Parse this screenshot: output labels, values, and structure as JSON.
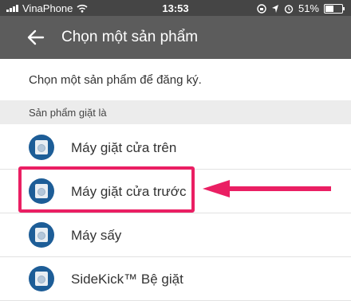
{
  "status_bar": {
    "carrier": "VinaPhone",
    "time": "13:53",
    "battery": "51%",
    "battery_level": 0.51
  },
  "app_bar": {
    "title": "Chọn một sản phẩm",
    "back_icon": "arrow-left-icon"
  },
  "prompt": "Chọn một sản phẩm để đăng ký.",
  "section": {
    "title": "Sản phẩm giặt là"
  },
  "products": [
    {
      "label": "Máy giặt cửa trên",
      "icon": "washer-icon"
    },
    {
      "label": "Máy giặt cửa trước",
      "icon": "washer-icon"
    },
    {
      "label": "Máy sấy",
      "icon": "dryer-icon"
    },
    {
      "label": "SideKick™ Bệ giặt",
      "icon": "pedestal-icon"
    }
  ],
  "annotation": {
    "highlight_color": "#ea1f63",
    "highlighted_item": "Máy giặt cửa trước"
  }
}
